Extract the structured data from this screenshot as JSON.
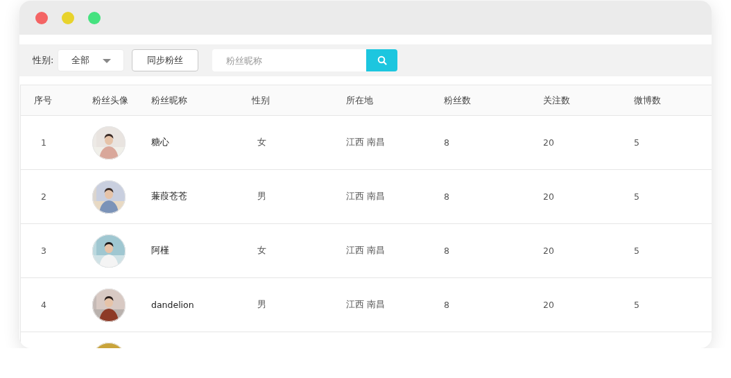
{
  "window": {
    "controls": [
      {
        "kind": "close"
      },
      {
        "kind": "minimize"
      },
      {
        "kind": "maximize"
      }
    ]
  },
  "toolbar": {
    "gender_label": "性别:",
    "gender_select": {
      "value": "全部"
    },
    "sync_button": "同步粉丝",
    "search": {
      "placeholder": "粉丝昵称"
    }
  },
  "table": {
    "columns": [
      "序号",
      "粉丝头像",
      "粉丝昵称",
      "性别",
      "所在地",
      "粉丝数",
      "关注数",
      "微博数"
    ],
    "rows": [
      {
        "index": "1",
        "nickname": "糖心",
        "gender": "女",
        "location": "江西 南昌",
        "fans": "8",
        "following": "20",
        "posts": "5"
      },
      {
        "index": "2",
        "nickname": "蒹葭苍苍",
        "gender": "男",
        "location": "江西 南昌",
        "fans": "8",
        "following": "20",
        "posts": "5"
      },
      {
        "index": "3",
        "nickname": "阿槿",
        "gender": "女",
        "location": "江西 南昌",
        "fans": "8",
        "following": "20",
        "posts": "5"
      },
      {
        "index": "4",
        "nickname": "dandelion",
        "gender": "男",
        "location": "江西 南昌",
        "fans": "8",
        "following": "20",
        "posts": "5"
      }
    ]
  }
}
